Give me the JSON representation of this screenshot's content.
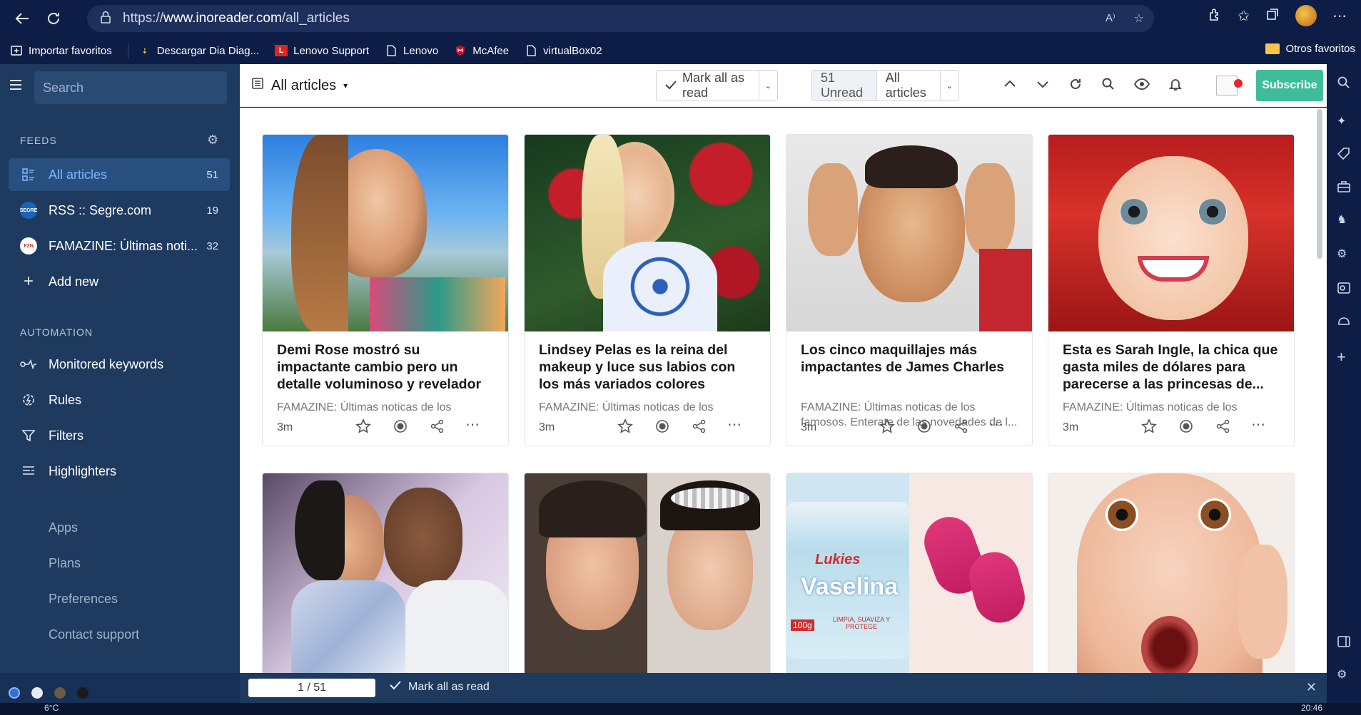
{
  "browser": {
    "url_prefix": "https://",
    "url_domain": "www.inoreader.com",
    "url_path": "/all_articles"
  },
  "bookmarks": [
    {
      "label": "Importar favoritos",
      "icon": "import-icon"
    },
    {
      "label": "Descargar Dia Diag...",
      "icon": "download-icon"
    },
    {
      "label": "Lenovo Support",
      "icon": "lenovo-icon"
    },
    {
      "label": "Lenovo",
      "icon": "page-icon"
    },
    {
      "label": "McAfee",
      "icon": "mcafee-icon"
    },
    {
      "label": "virtualBox02",
      "icon": "page-icon"
    }
  ],
  "bookmarks_right": "Otros favoritos",
  "sidebar": {
    "search_placeholder": "Search",
    "feeds_heading": "FEEDS",
    "feeds": [
      {
        "label": "All articles",
        "count": "51",
        "active": true
      },
      {
        "label": "RSS :: Segre.com",
        "count": "19",
        "active": false
      },
      {
        "label": "FAMAZINE: Últimas noti...",
        "count": "32",
        "active": false
      }
    ],
    "add_new": "Add new",
    "automation_heading": "AUTOMATION",
    "automation": [
      "Monitored keywords",
      "Rules",
      "Filters",
      "Highlighters"
    ],
    "links": [
      "Apps",
      "Plans",
      "Preferences",
      "Contact support"
    ]
  },
  "header": {
    "title": "All articles",
    "mark_all": "Mark all as read",
    "unread": "51 Unread",
    "filter": "All articles",
    "subscribe": "Subscribe"
  },
  "cards": [
    {
      "title": "Demi Rose mostró su impactante cambio pero un detalle voluminoso y revelador hizo que su foto se...",
      "source": "FAMAZINE: Últimas noticas de los",
      "time": "3m"
    },
    {
      "title": "Lindsey Pelas es la reina del makeup y luce sus labios con los más variados colores",
      "source": "FAMAZINE: Últimas noticas de los",
      "time": "3m"
    },
    {
      "title": "Los cinco maquillajes más impactantes de James Charles",
      "source": "FAMAZINE: Últimas noticas de los famosos. Enterate de las novedades de l...",
      "time": "3m"
    },
    {
      "title": "Esta es Sarah Ingle, la chica que gasta miles de dólares para parecerse a las princesas de...",
      "source": "FAMAZINE: Últimas noticas de los",
      "time": "3m"
    }
  ],
  "second_row_text": {
    "vaseline_brand": "Vaselina",
    "vaseline_small": "LIMPIA, SUAVIZA Y PROTEGE",
    "vaseline_weight": "100g",
    "vaseline_maker": "Lukies"
  },
  "statusbar": {
    "pager": "1 / 51",
    "mark_all": "Mark all as read"
  },
  "taskbar": {
    "temp": "6°C",
    "time": "20:46"
  }
}
